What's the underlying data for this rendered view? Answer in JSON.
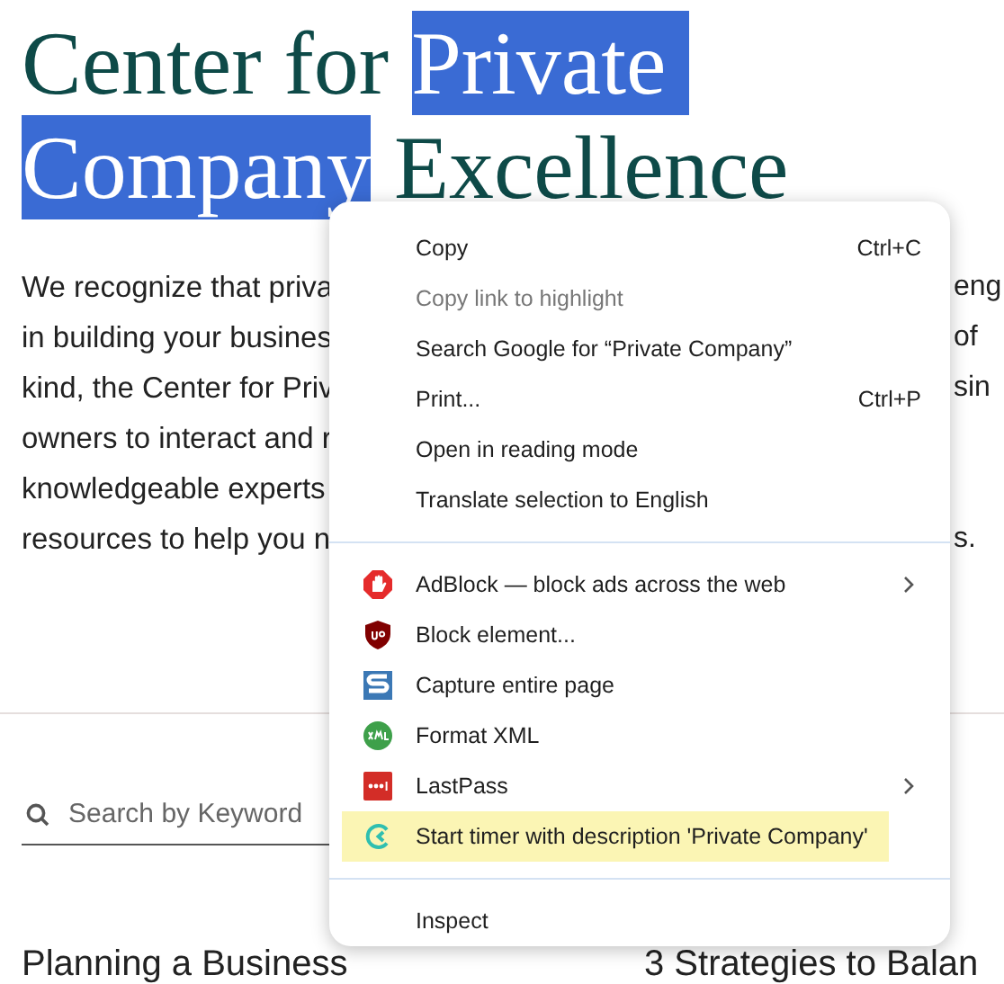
{
  "heading": {
    "lines": [
      [
        {
          "text": "Center for ",
          "selected": false
        },
        {
          "text": "Private ",
          "selected": true
        }
      ],
      [
        {
          "text": "Company",
          "selected": true
        },
        {
          "text": " Excellence",
          "selected": false
        }
      ]
    ]
  },
  "intro": {
    "lines": [
      {
        "left": "We recognize that priva",
        "right": "eng"
      },
      {
        "left": "in building your busines",
        "right": "of"
      },
      {
        "left": "kind, the Center for Priv",
        "right": "sin"
      },
      {
        "left": "owners to interact and r"
      },
      {
        "left": "knowledgeable experts"
      },
      {
        "left": "resources to help you n",
        "right": "s."
      }
    ]
  },
  "search": {
    "placeholder": "Search by Keyword"
  },
  "articles": [
    {
      "title": "Planning a Business"
    },
    {
      "title": "3 Strategies to Balan"
    }
  ],
  "context_menu": {
    "items": [
      {
        "kind": "plain",
        "label": "Copy",
        "shortcut": "Ctrl+C",
        "disabled": false,
        "selected": false
      },
      {
        "kind": "plain",
        "label": "Copy link to highlight",
        "disabled": true,
        "selected": false
      },
      {
        "kind": "plain",
        "label": "Search Google for “Private Company”",
        "disabled": false,
        "selected": false
      },
      {
        "kind": "plain",
        "label": "Print...",
        "shortcut": "Ctrl+P",
        "disabled": false,
        "selected": false
      },
      {
        "kind": "plain",
        "label": "Open in reading mode",
        "disabled": false,
        "selected": false
      },
      {
        "kind": "plain",
        "label": "Translate selection to English",
        "disabled": false,
        "selected": false
      },
      {
        "kind": "separator"
      },
      {
        "kind": "extension",
        "label": "AdBlock — block ads across the web",
        "submenu": true,
        "disabled": false,
        "selected": false
      },
      {
        "kind": "extension",
        "label": "Block element...",
        "disabled": false,
        "selected": false
      },
      {
        "kind": "extension",
        "label": "Capture entire page",
        "disabled": false,
        "selected": false
      },
      {
        "kind": "extension",
        "label": "Format XML",
        "disabled": false,
        "selected": false
      },
      {
        "kind": "extension",
        "label": "LastPass",
        "submenu": true,
        "disabled": false,
        "selected": false
      },
      {
        "kind": "extension",
        "label": "Start timer with description 'Private Company'",
        "disabled": false,
        "selected": true
      },
      {
        "kind": "separator"
      },
      {
        "kind": "plain",
        "label": "Inspect",
        "disabled": false,
        "selected": false
      }
    ]
  }
}
